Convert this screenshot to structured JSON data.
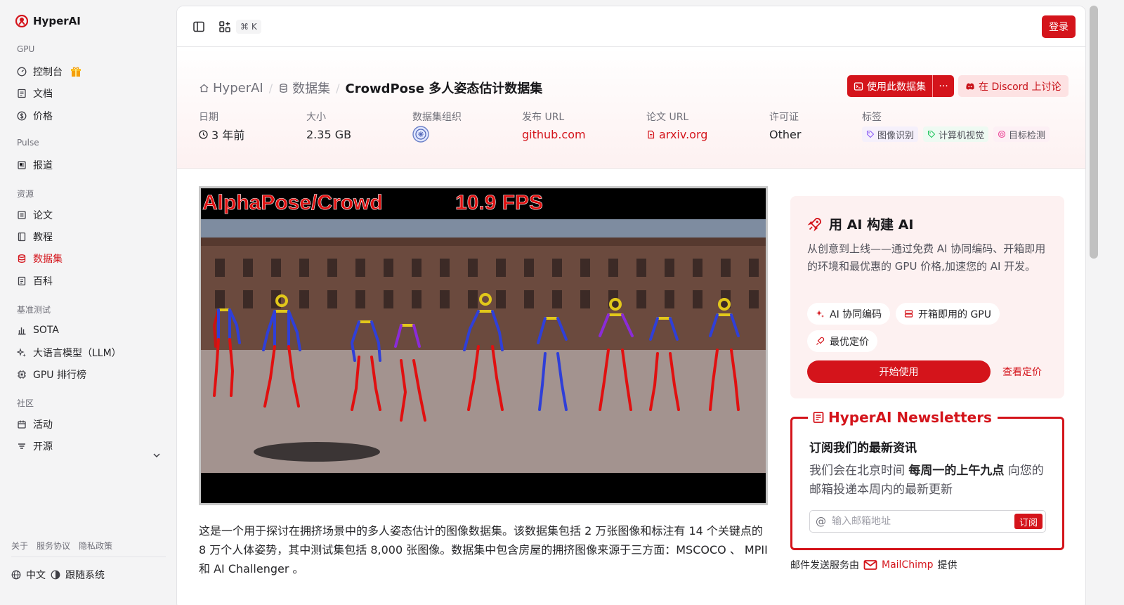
{
  "app": {
    "name": "HyperAI"
  },
  "sidebar": {
    "sections": [
      {
        "title": "GPU"
      },
      {
        "title": "Pulse"
      },
      {
        "title": "资源"
      },
      {
        "title": "基准测试"
      },
      {
        "title": "社区"
      }
    ],
    "items": [
      {
        "label": "控制台"
      },
      {
        "label": "文档"
      },
      {
        "label": "价格"
      },
      {
        "label": "报道"
      },
      {
        "label": "论文"
      },
      {
        "label": "教程"
      },
      {
        "label": "数据集"
      },
      {
        "label": "百科"
      },
      {
        "label": "SOTA"
      },
      {
        "label": "大语言模型（LLM）"
      },
      {
        "label": "GPU 排行榜"
      },
      {
        "label": "活动"
      },
      {
        "label": "开源"
      }
    ],
    "active_item": "数据集",
    "footer_links": [
      "关于",
      "服务协议",
      "隐私政策"
    ],
    "language": "中文",
    "theme": "跟随系统"
  },
  "topbar": {
    "shortcut": "⌘ K",
    "login": "登录"
  },
  "breadcrumb": {
    "home": "HyperAI",
    "section": "数据集",
    "current": "CrowdPose 多人姿态估计数据集"
  },
  "actions": {
    "use_dataset": "使用此数据集",
    "more": "···",
    "discord": "在 Discord 上讨论"
  },
  "meta": {
    "date_label": "日期",
    "date_value": "3 年前",
    "size_label": "大小",
    "size_value": "2.35 GB",
    "org_label": "数据集组织",
    "release_label": "发布 URL",
    "release_value": "github.com",
    "paper_label": "论文 URL",
    "paper_value": "arxiv.org",
    "license_label": "许可证",
    "license_value": "Other",
    "tags_label": "标签",
    "tags": [
      "图像识别",
      "计算机视觉",
      "目标检测"
    ]
  },
  "image": {
    "caption_left": "AlphaPose/Crowd",
    "caption_right": "10.9 FPS"
  },
  "description": "这是一个用于探讨在拥挤场景中的多人姿态估计的图像数据集。该数据集包括 2 万张图像和标注有 14 个关键点的 8 万个人体姿势，其中测试集包括 8,000 张图像。数据集中包含房屋的拥挤图像来源于三方面：MSCOCO 、 MPII 和 AI Challenger 。",
  "promo": {
    "title": "用 AI 构建 AI",
    "description": "从创意到上线——通过免费 AI 协同编码、开箱即用的环境和最优惠的 GPU 价格,加速您的 AI 开发。",
    "features": [
      "AI 协同编码",
      "开箱即用的 GPU",
      "最优定价"
    ],
    "start": "开始使用",
    "pricing": "查看定价"
  },
  "newsletter": {
    "header": "HyperAI Newsletters",
    "title": "订阅我们的最新资讯",
    "desc_pre": "我们会在北京时间 ",
    "desc_bold": "每周一的上午九点",
    "desc_post": " 向您的邮箱投递本周内的最新更新",
    "placeholder": "输入邮箱地址",
    "subscribe": "订阅",
    "credit_pre": "邮件发送服务由",
    "credit_brand": "MailChimp",
    "credit_post": "提供"
  },
  "colors": {
    "accent": "#d4141b",
    "accent_soft": "#fde2e3"
  }
}
